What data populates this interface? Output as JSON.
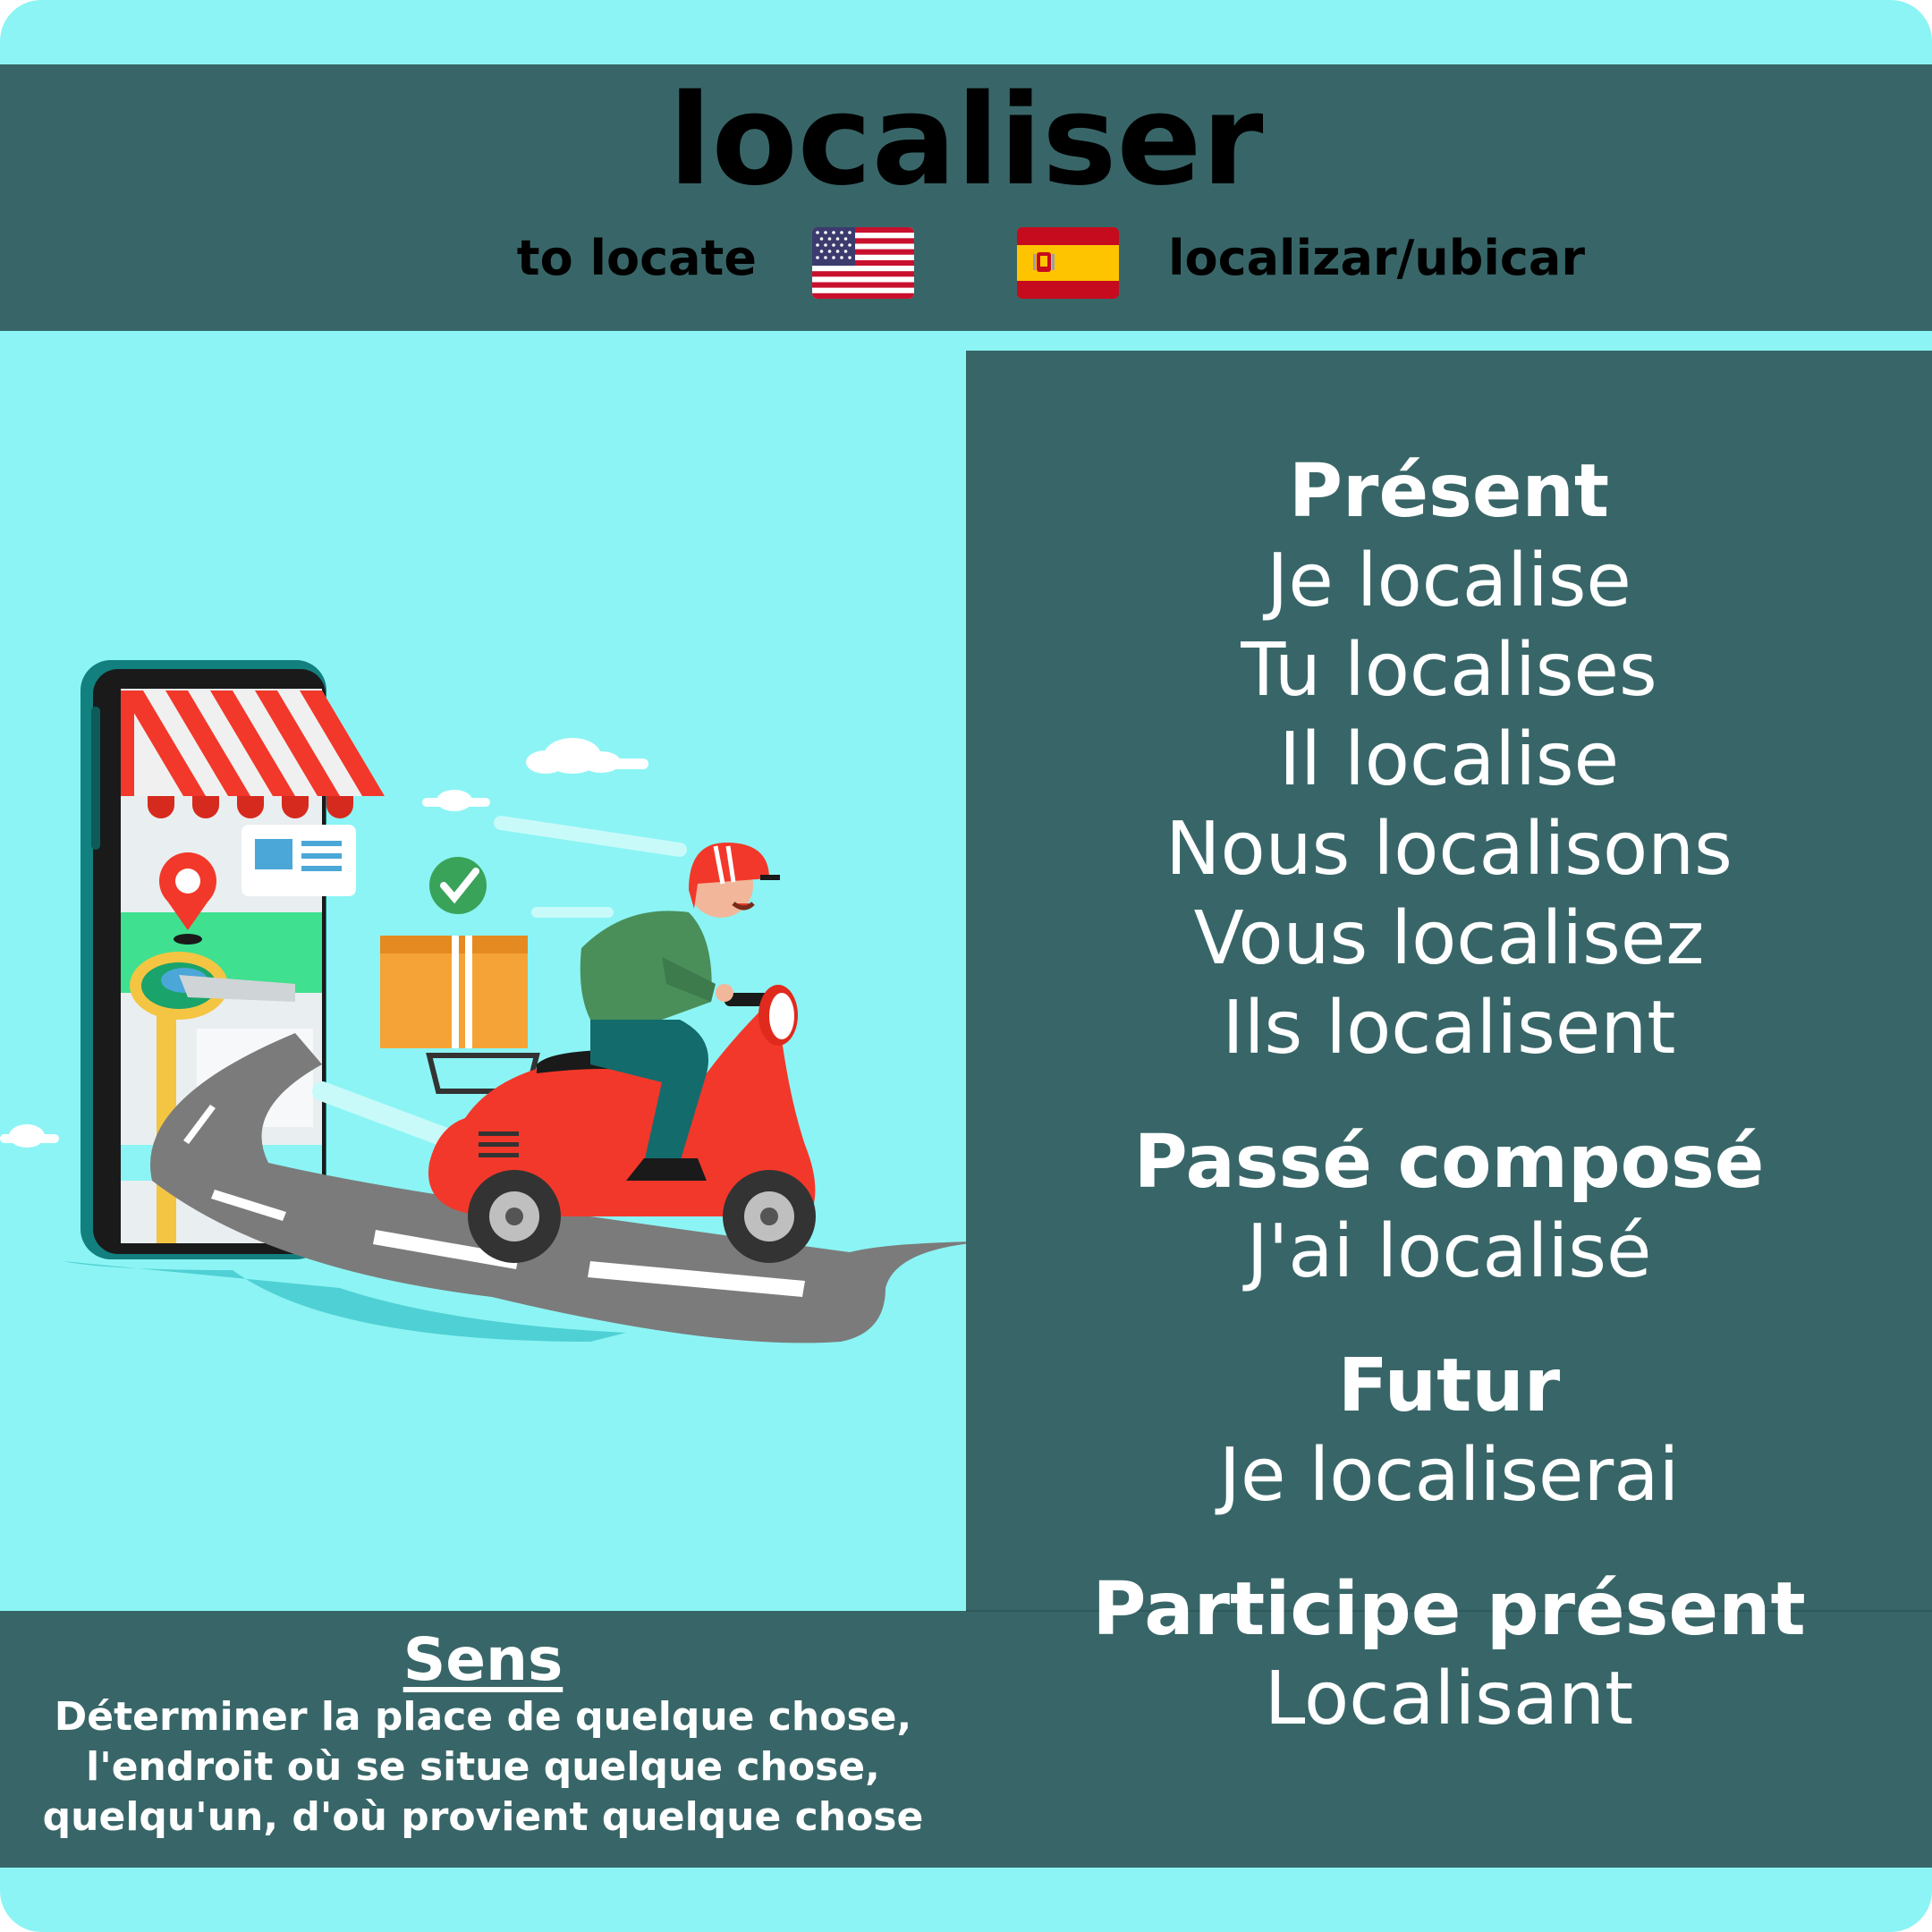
{
  "verb": "localiser",
  "translations": {
    "english": "to locate",
    "english_flag": "us-flag-icon",
    "spanish": "localizar/ubicar",
    "spanish_flag": "spain-flag-icon"
  },
  "conjugations": [
    {
      "tense": "Présent",
      "forms": [
        "Je localise",
        "Tu localises",
        "Il localise",
        "Nous localisons",
        "Vous localisez",
        "Ils localisent"
      ]
    },
    {
      "tense": "Passé composé",
      "forms": [
        "J'ai localisé"
      ]
    },
    {
      "tense": "Futur",
      "forms": [
        "Je localiserai"
      ]
    },
    {
      "tense": "Participe présent",
      "forms": [
        "Localisant"
      ]
    }
  ],
  "sens": {
    "title": "Sens",
    "lines": [
      "Déterminer la place de quelque chose,",
      "l'endroit où se situe quelque chose,",
      "quelqu'un, d'où provient quelque chose"
    ]
  },
  "illustration": "delivery-scooter-illustration",
  "colors": {
    "background": "#8cf4f4",
    "panel": "#386668",
    "text": "#ffffff"
  }
}
